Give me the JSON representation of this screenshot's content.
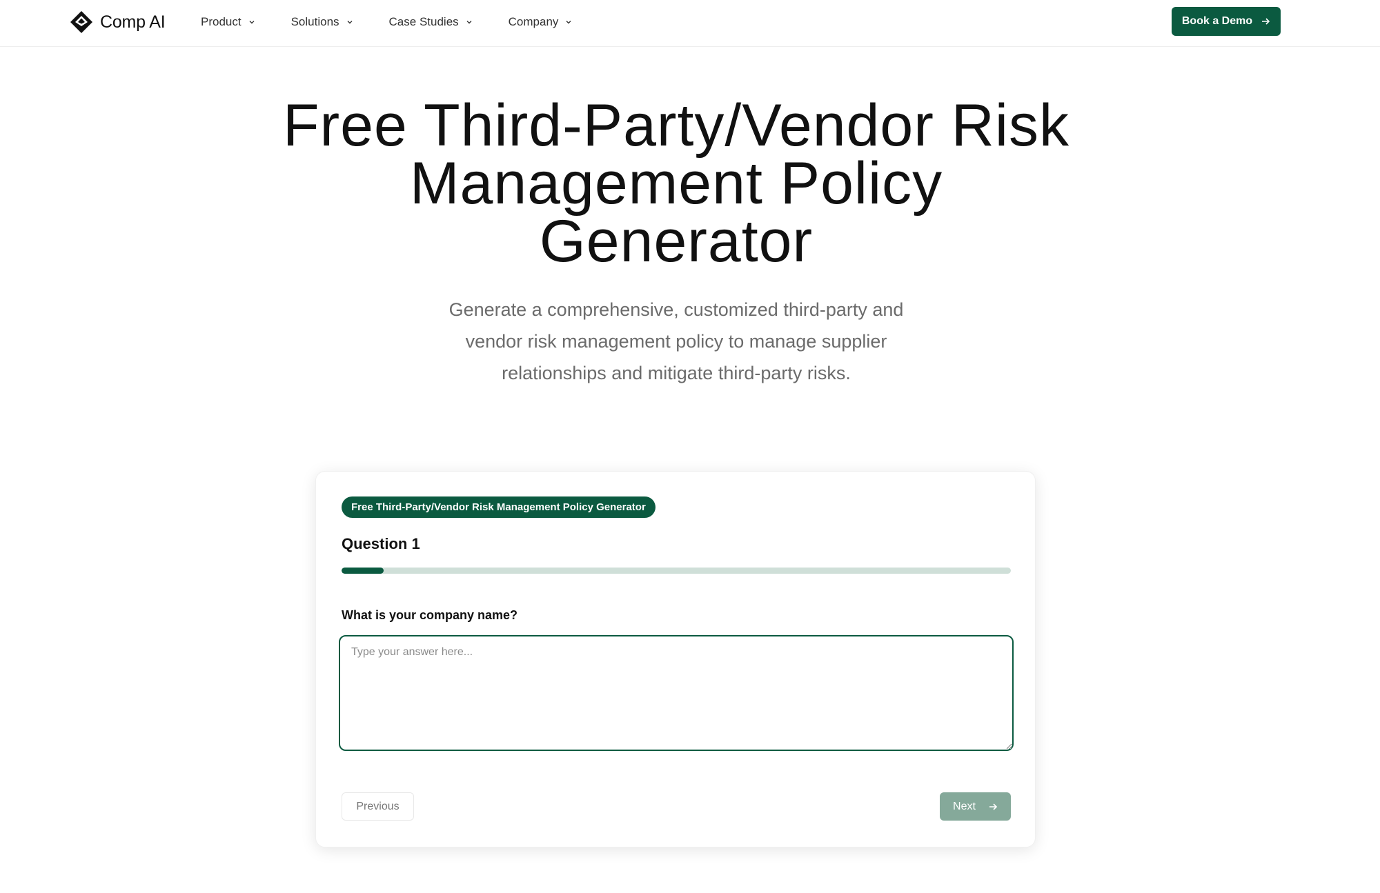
{
  "header": {
    "brand": "Comp AI",
    "nav": [
      {
        "label": "Product"
      },
      {
        "label": "Solutions"
      },
      {
        "label": "Case Studies"
      },
      {
        "label": "Company"
      }
    ],
    "cta_label": "Book a Demo"
  },
  "hero": {
    "title": "Free Third-Party/Vendor Risk Management Policy Generator",
    "subtitle": "Generate a comprehensive, customized third-party and vendor risk management policy to manage supplier relationships and mitigate third-party risks."
  },
  "form": {
    "badge": "Free Third-Party/Vendor Risk Management Policy Generator",
    "question_heading": "Question 1",
    "progress_fraction": 0.063,
    "question_label": "What is your company name?",
    "answer_value": "",
    "answer_placeholder": "Type your answer here...",
    "previous_label": "Previous",
    "next_label": "Next"
  },
  "colors": {
    "brand_green": "#0b5a40",
    "next_disabled": "#85a99a",
    "progress_track": "#cfdfd8"
  },
  "icons": {
    "logo": "comp-ai-logo-icon",
    "nav_chevron": "chevron-down-icon",
    "arrow": "arrow-right-icon"
  }
}
